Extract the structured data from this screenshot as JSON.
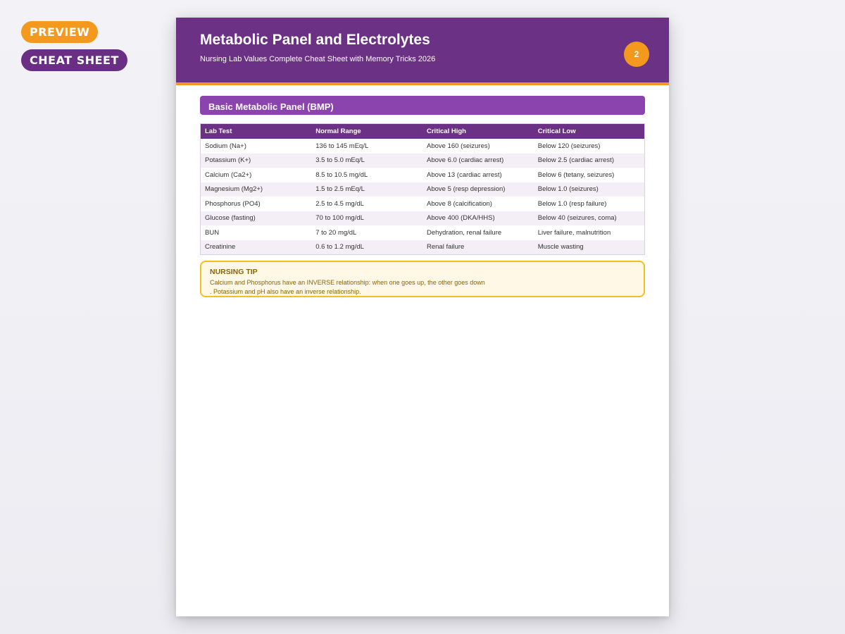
{
  "badges": {
    "preview": "PREVIEW",
    "cheat_sheet": "CHEAT SHEET"
  },
  "page": {
    "title": "Metabolic Panel and Electrolytes",
    "subtitle": "Nursing Lab Values Complete Cheat Sheet with Memory Tricks 2026",
    "number": "2"
  },
  "section": {
    "title": "Basic Metabolic Panel (BMP)"
  },
  "table": {
    "headers": [
      "Lab Test",
      "Normal Range",
      "Critical High",
      "Critical Low"
    ],
    "rows": [
      [
        "Sodium (Na+)",
        "136 to 145 mEq/L",
        "Above 160 (seizures)",
        "Below 120 (seizures)"
      ],
      [
        "Potassium (K+)",
        "3.5 to 5.0 mEq/L",
        "Above 6.0 (cardiac arrest)",
        "Below 2.5 (cardiac arrest)"
      ],
      [
        "Calcium (Ca2+)",
        "8.5 to 10.5 mg/dL",
        "Above 13 (cardiac arrest)",
        "Below 6 (tetany, seizures)"
      ],
      [
        "Magnesium (Mg2+)",
        "1.5 to 2.5 mEq/L",
        "Above 5 (resp depression)",
        "Below 1.0 (seizures)"
      ],
      [
        "Phosphorus (PO4)",
        "2.5 to 4.5 mg/dL",
        "Above 8 (calcification)",
        "Below 1.0 (resp failure)"
      ],
      [
        "Glucose (fasting)",
        "70 to 100 mg/dL",
        "Above 400 (DKA/HHS)",
        "Below 40 (seizures, coma)"
      ],
      [
        "BUN",
        "7 to 20 mg/dL",
        "Dehydration, renal failure",
        "Liver failure, malnutrition"
      ],
      [
        "Creatinine",
        "0.6 to 1.2 mg/dL",
        "Renal failure",
        "Muscle wasting"
      ]
    ]
  },
  "tip": {
    "title": "NURSING TIP",
    "line1": "Calcium and Phosphorus have an INVERSE relationship: when one goes up, the other goes down",
    "line2": ". Potassium and pH also have an inverse relationship."
  },
  "colors": {
    "header_purple": "#6b3185",
    "section_purple": "#8b44ad",
    "accent_orange": "#f39a1e",
    "tip_border": "#f0c020",
    "tip_background": "#fff8e6",
    "row_alt": "#f4eff7"
  }
}
